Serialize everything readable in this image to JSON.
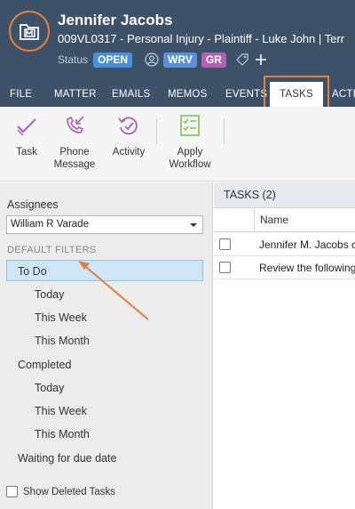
{
  "header": {
    "client_name": "Jennifer Jacobs",
    "matter_line": "009VL0317 - Personal Injury - Plaintiff - Luke John | Terr",
    "status_label": "Status",
    "status_value": "OPEN",
    "badges": [
      "WRV",
      "GR"
    ],
    "icons": [
      "folder-icon",
      "user-circle-icon",
      "tag-icon",
      "plus-icon"
    ]
  },
  "nav": {
    "tabs": [
      "FILE",
      "MATTER",
      "EMAILS",
      "MEMOS",
      "EVENTS",
      "TASKS",
      "ACTIVI"
    ],
    "active_tab": "TASKS"
  },
  "toolbar": {
    "task": "Task",
    "phone_message_line1": "Phone",
    "phone_message_line2": "Message",
    "activity": "Activity",
    "apply_workflow_line1": "Apply",
    "apply_workflow_line2": "Workflow"
  },
  "left_panel": {
    "assignees_label": "Assignees",
    "assignee_value": "William R Varade",
    "filters_header": "DEFAULT FILTERS",
    "filters": {
      "todo": "To Do",
      "todo_today": "Today",
      "todo_week": "This Week",
      "todo_month": "This Month",
      "completed": "Completed",
      "completed_today": "Today",
      "completed_week": "This Week",
      "completed_month": "This Month",
      "waiting": "Waiting for due date"
    },
    "show_deleted": "Show Deleted Tasks"
  },
  "tasks": {
    "header": "TASKS (2)",
    "column_name": "Name",
    "rows": [
      "Jennifer M. Jacobs ca",
      "Review the following"
    ]
  },
  "colors": {
    "header_bg": "#3d5269",
    "accent_orange": "#e57e3b",
    "badge_open": "#4a90d9",
    "badge_wrv": "#5b8fd6",
    "badge_gr": "#b25fb5",
    "icon_purple": "#b05bb3",
    "icon_green": "#7fbf5a",
    "selected_filter": "#cfe6f7"
  }
}
